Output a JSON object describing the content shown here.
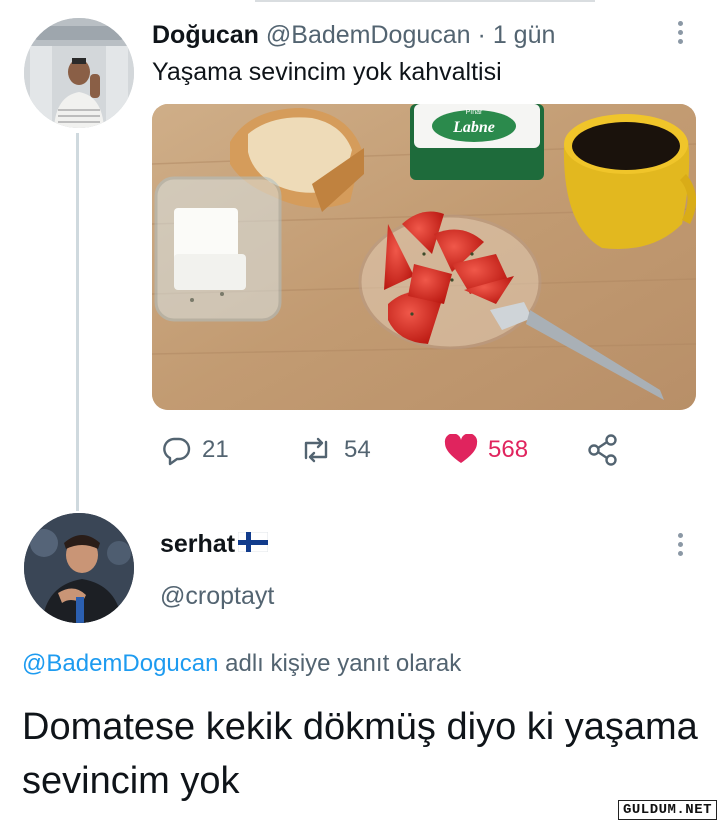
{
  "original_tweet": {
    "display_name": "Doğucan",
    "handle": "@BademDogucan",
    "separator": "·",
    "time": "1 gün",
    "text": "Yaşama sevincim yok kahvaltisi",
    "media_label": "Labne",
    "media_brand": "Pınar",
    "actions": {
      "replies": "21",
      "retweets": "54",
      "likes": "568"
    }
  },
  "reply": {
    "display_name": "serhat",
    "flag_icon": "finland-flag-icon",
    "handle": "@croptayt",
    "reply_to_mention": "@BademDogucan",
    "reply_to_suffix": "adlı kişiye yanıt olarak",
    "text": "Domatese kekik dökmüş diyo ki yaşama sevincim yok"
  },
  "watermark": "GULDUM.NET",
  "colors": {
    "like": "#e0245e",
    "mention": "#1d9bf0",
    "muted": "#536471",
    "thread_line": "#cfd9de"
  },
  "icons": {
    "reply": "reply-icon",
    "retweet": "retweet-icon",
    "like": "heart-icon",
    "share": "share-icon",
    "more": "more-vertical-icon"
  }
}
